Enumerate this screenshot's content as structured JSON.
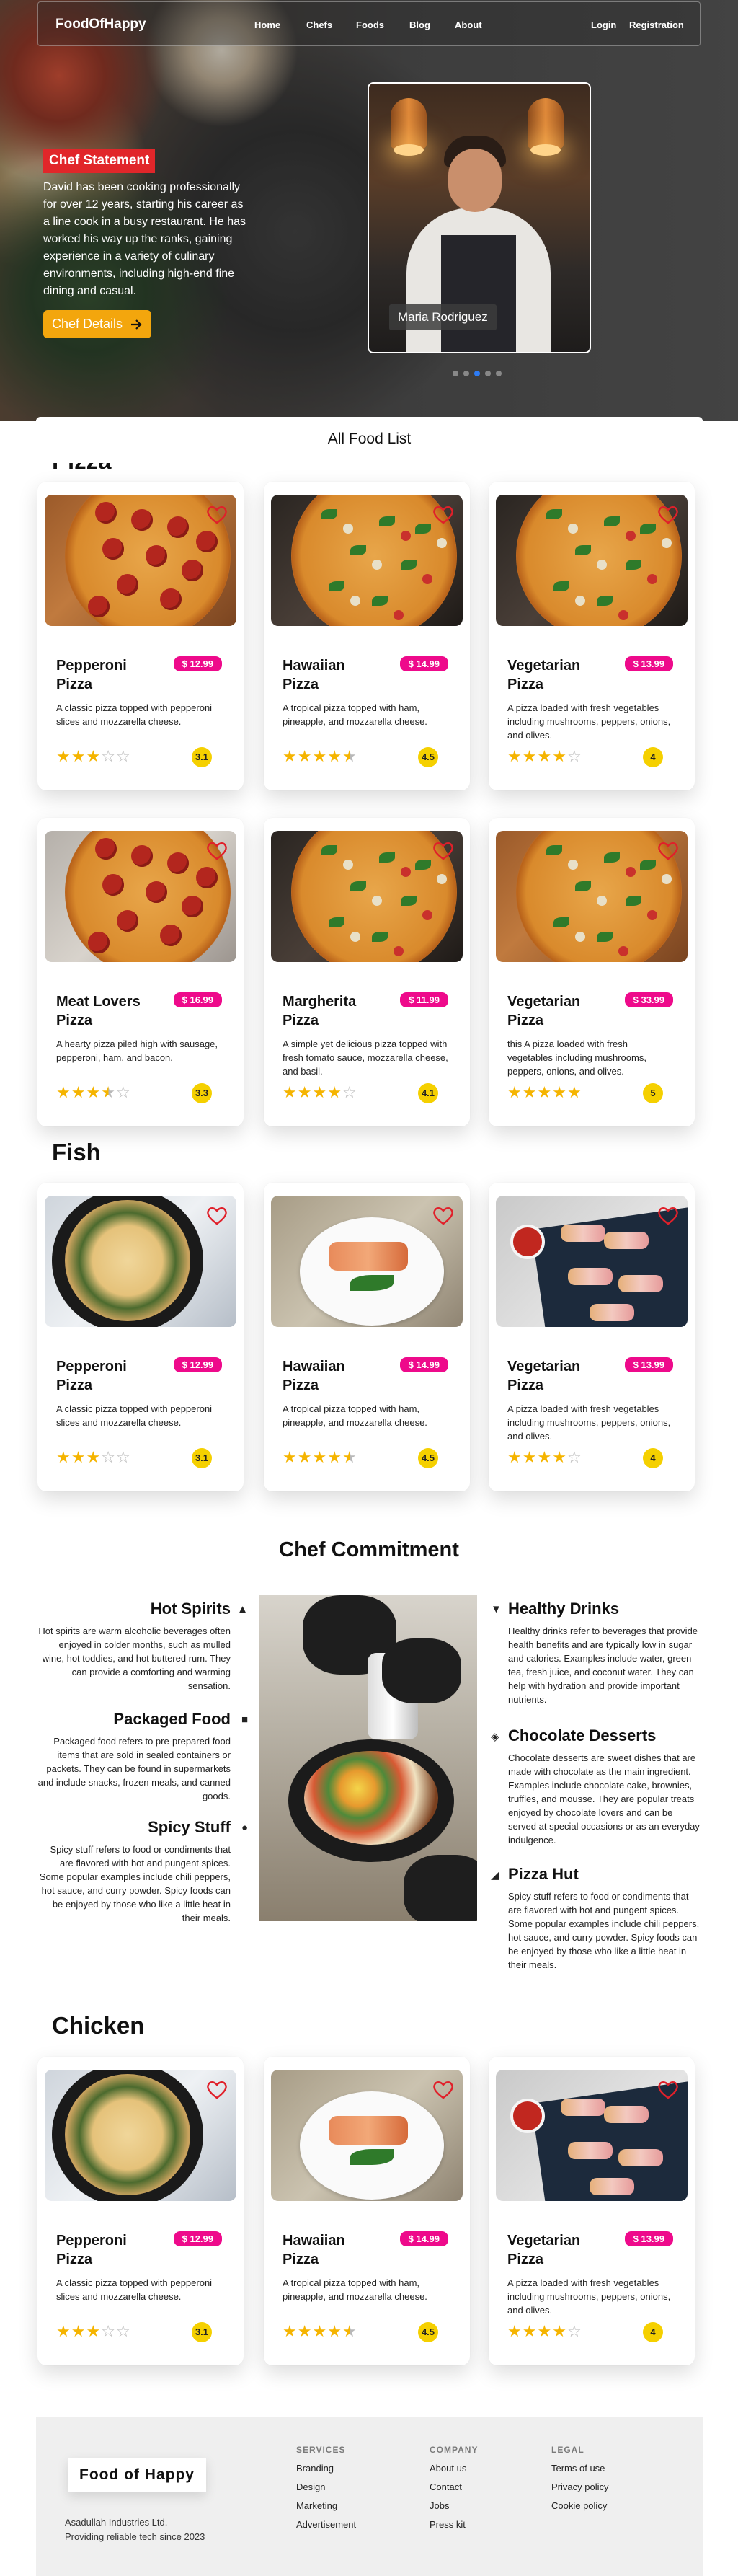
{
  "nav": {
    "brand": "FoodOfHappy",
    "links": [
      "Home",
      "Chefs",
      "Foods",
      "Blog",
      "About"
    ],
    "login": "Login",
    "registration": "Registration"
  },
  "hero": {
    "badge": "Chef Statement",
    "text": "David has been cooking professionally for over 12 years, starting his career as a line cook in a busy restaurant. He has worked his way up the ranks, gaining experience in a variety of culinary environments, including high-end fine dining and casual.",
    "button": "Chef Details",
    "chef_name": "Maria Rodriguez",
    "slides": 5,
    "active_slide": 2
  },
  "food_list_title": "All Food List",
  "sections": {
    "pizza": {
      "title": "Pizza",
      "items": [
        {
          "name": "Pepperoni Pizza",
          "price": "$ 12.99",
          "desc": "A classic pizza topped with pepperoni slices and mozzarella cheese.",
          "stars": 3,
          "rating": "3.1"
        },
        {
          "name": "Hawaiian Pizza",
          "price": "$ 14.99",
          "desc": "A tropical pizza topped with ham, pineapple, and mozzarella cheese.",
          "stars": 4.5,
          "rating": "4.5"
        },
        {
          "name": "Vegetarian Pizza",
          "price": "$ 13.99",
          "desc": "A pizza loaded with fresh vegetables including mushrooms, peppers, onions, and olives.",
          "stars": 4,
          "rating": "4"
        },
        {
          "name": "Meat Lovers Pizza",
          "price": "$ 16.99",
          "desc": "A hearty pizza piled high with sausage, pepperoni, ham, and bacon.",
          "stars": 3.5,
          "rating": "3.3"
        },
        {
          "name": "Margherita Pizza",
          "price": "$ 11.99",
          "desc": "A simple yet delicious pizza topped with fresh tomato sauce, mozzarella cheese, and basil.",
          "stars": 4,
          "rating": "4.1"
        },
        {
          "name": "Vegetarian Pizza",
          "price": "$ 33.99",
          "desc": "this A pizza loaded with fresh vegetables including mushrooms, peppers, onions, and olives.",
          "stars": 5,
          "rating": "5"
        }
      ]
    },
    "fish": {
      "title": "Fish",
      "items": [
        {
          "name": "Pepperoni Pizza",
          "price": "$ 12.99",
          "desc": "A classic pizza topped with pepperoni slices and mozzarella cheese.",
          "stars": 3,
          "rating": "3.1"
        },
        {
          "name": "Hawaiian Pizza",
          "price": "$ 14.99",
          "desc": "A tropical pizza topped with ham, pineapple, and mozzarella cheese.",
          "stars": 4.5,
          "rating": "4.5"
        },
        {
          "name": "Vegetarian Pizza",
          "price": "$ 13.99",
          "desc": "A pizza loaded with fresh vegetables including mushrooms, peppers, onions, and olives.",
          "stars": 4,
          "rating": "4"
        }
      ]
    },
    "chicken": {
      "title": "Chicken",
      "items": [
        {
          "name": "Pepperoni Pizza",
          "price": "$ 12.99",
          "desc": "A classic pizza topped with pepperoni slices and mozzarella cheese.",
          "stars": 3,
          "rating": "3.1"
        },
        {
          "name": "Hawaiian Pizza",
          "price": "$ 14.99",
          "desc": "A tropical pizza topped with ham, pineapple, and mozzarella cheese.",
          "stars": 4.5,
          "rating": "4.5"
        },
        {
          "name": "Vegetarian Pizza",
          "price": "$ 13.99",
          "desc": "A pizza loaded with fresh vegetables including mushrooms, peppers, onions, and olives.",
          "stars": 4,
          "rating": "4"
        }
      ]
    }
  },
  "commitment": {
    "title": "Chef Commitment",
    "left": [
      {
        "title": "Hot Spirits",
        "text": "Hot spirits are warm alcoholic beverages often enjoyed in colder months, such as mulled wine, hot toddies, and hot buttered rum. They can provide a comforting and warming sensation."
      },
      {
        "title": "Packaged Food",
        "text": "Packaged food refers to pre-prepared food items that are sold in sealed containers or packets. They can be found in supermarkets and include snacks, frozen meals, and canned goods."
      },
      {
        "title": "Spicy Stuff",
        "text": "Spicy stuff refers to food or condiments that are flavored with hot and pungent spices. Some popular examples include chili peppers, hot sauce, and curry powder. Spicy foods can be enjoyed by those who like a little heat in their meals."
      }
    ],
    "right": [
      {
        "title": "Healthy Drinks",
        "text": "Healthy drinks refer to beverages that provide health benefits and are typically low in sugar and calories. Examples include water, green tea, fresh juice, and coconut water. They can help with hydration and provide important nutrients."
      },
      {
        "title": "Chocolate Desserts",
        "text": "Chocolate desserts are sweet dishes that are made with chocolate as the main ingredient. Examples include chocolate cake, brownies, truffles, and mousse. They are popular treats enjoyed by chocolate lovers and can be served at special occasions or as an everyday indulgence."
      },
      {
        "title": "Pizza Hut",
        "text": "Spicy stuff refers to food or condiments that are flavored with hot and pungent spices. Some popular examples include chili peppers, hot sauce, and curry powder. Spicy foods can be enjoyed by those who like a little heat in their meals."
      }
    ]
  },
  "footer": {
    "brand": "Food of Happy",
    "company": "Asadullah Industries Ltd.",
    "tagline": "Providing reliable tech since 2023",
    "services_title": "SERVICES",
    "services": [
      "Branding",
      "Design",
      "Marketing",
      "Advertisement"
    ],
    "company_title": "COMPANY",
    "company_links": [
      "About us",
      "Contact",
      "Jobs",
      "Press kit"
    ],
    "legal_title": "LEGAL",
    "legal": [
      "Terms of use",
      "Privacy policy",
      "Cookie policy"
    ]
  },
  "colors": {
    "price_badge": "#ee0a8b",
    "star": "#f5b400",
    "rating_badge": "#f5d000",
    "hero_badge": "#e1262a",
    "hero_button": "#f3a60d",
    "active_dot": "#2d7cf5"
  }
}
